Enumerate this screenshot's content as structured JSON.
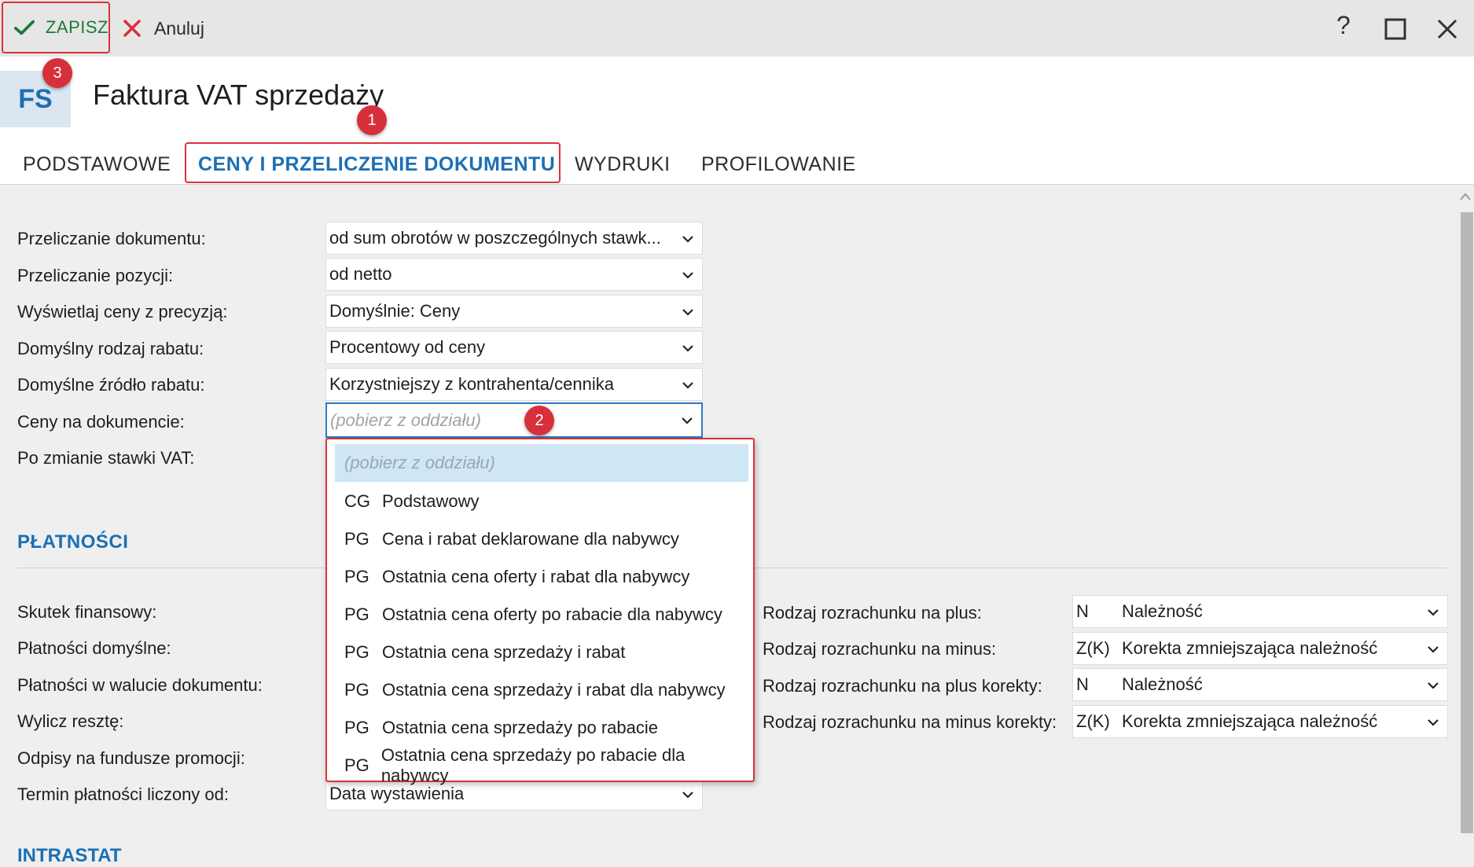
{
  "toolbar": {
    "save_label": "ZAPISZ",
    "cancel_label": "Anuluj",
    "help_glyph": "?"
  },
  "header": {
    "badge": "FS",
    "title": "Faktura VAT sprzedaży"
  },
  "markers": [
    "1",
    "2",
    "3"
  ],
  "tabs": [
    {
      "label": "PODSTAWOWE"
    },
    {
      "label": "CENY I PRZELICZENIE DOKUMENTU"
    },
    {
      "label": "WYDRUKI"
    },
    {
      "label": "PROFILOWANIE"
    }
  ],
  "pricing_fields": [
    {
      "label": "Przeliczanie dokumentu:",
      "value": "od sum obrotów w poszczególnych stawk..."
    },
    {
      "label": "Przeliczanie pozycji:",
      "value": "od netto"
    },
    {
      "label": "Wyświetlaj ceny z precyzją:",
      "value": "Domyślnie: Ceny"
    },
    {
      "label": "Domyślny rodzaj rabatu:",
      "value": "Procentowy od ceny"
    },
    {
      "label": "Domyślne źródło rabatu:",
      "value": "Korzystniejszy z kontrahenta/cennika"
    },
    {
      "label": "Ceny na dokumencie:",
      "value": "(pobierz z oddziału)"
    },
    {
      "label": "Po zmianie stawki VAT:",
      "value": ""
    }
  ],
  "dropdown": {
    "selected": "(pobierz z oddziału)",
    "items": [
      {
        "code": "CG",
        "label": "Podstawowy"
      },
      {
        "code": "PG",
        "label": "Cena i rabat deklarowane dla nabywcy"
      },
      {
        "code": "PG",
        "label": "Ostatnia cena oferty i rabat dla nabywcy"
      },
      {
        "code": "PG",
        "label": "Ostatnia cena oferty po rabacie dla nabywcy"
      },
      {
        "code": "PG",
        "label": "Ostatnia cena sprzedaży i rabat"
      },
      {
        "code": "PG",
        "label": "Ostatnia cena sprzedaży i rabat dla nabywcy"
      },
      {
        "code": "PG",
        "label": "Ostatnia cena sprzedaży po rabacie"
      },
      {
        "code": "PG",
        "label": "Ostatnia cena sprzedaży po rabacie dla nabywcy"
      }
    ]
  },
  "payments": {
    "section_title": "PŁATNOŚCI",
    "left_labels": [
      "Skutek finansowy:",
      "Płatności domyślne:",
      "Płatności w walucie dokumentu:",
      "Wylicz resztę:",
      "Odpisy na fundusze promocji:",
      "Termin płatności liczony od:"
    ],
    "payment_term_value": "Data wystawienia",
    "right_fields": [
      {
        "label": "Rodzaj rozrachunku na plus:",
        "code": "N",
        "value": "Należność"
      },
      {
        "label": "Rodzaj rozrachunku na minus:",
        "code": "Z(K)",
        "value": "Korekta zmniejszająca należność"
      },
      {
        "label": "Rodzaj rozrachunku na plus korekty:",
        "code": "N",
        "value": "Należność"
      },
      {
        "label": "Rodzaj rozrachunku na minus korekty:",
        "code": "Z(K)",
        "value": "Korekta zmniejszająca należność"
      }
    ]
  },
  "intrastat": {
    "section_title": "INTRASTAT"
  },
  "colors": {
    "accent": "#1c6fb4",
    "highlight": "#d9333a",
    "save_green": "#1b7a35",
    "selected_bg": "#cfe6f5"
  },
  "icons": [
    "check-icon",
    "close-x-icon",
    "help-icon",
    "maximize-icon",
    "window-close-icon",
    "chevron-down-icon"
  ]
}
